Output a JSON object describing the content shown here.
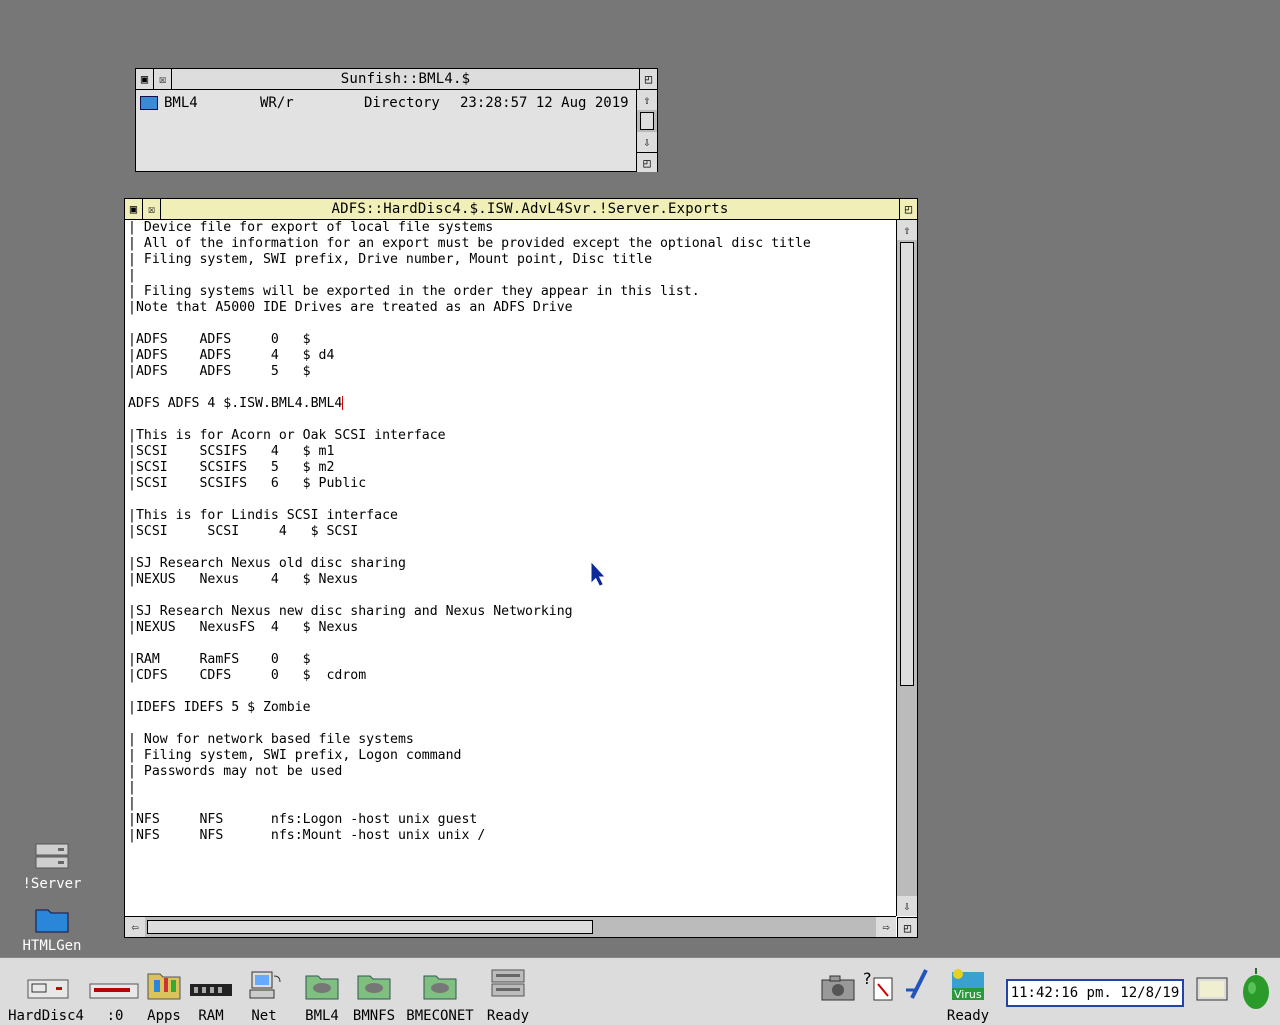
{
  "filer_window": {
    "title": "Sunfish::BML4.$",
    "row": {
      "name": "BML4",
      "access": "WR/r",
      "type": "Directory",
      "date": "23:28:57 12 Aug 2019"
    }
  },
  "editor_window": {
    "title": "ADFS::HardDisc4.$.ISW.AdvL4Svr.!Server.Exports",
    "lines": [
      "| Device file for export of local file systems",
      "| All of the information for an export must be provided except the optional disc title",
      "| Filing system, SWI prefix, Drive number, Mount point, Disc title",
      "|",
      "| Filing systems will be exported in the order they appear in this list.",
      "|Note that A5000 IDE Drives are treated as an ADFS Drive",
      "",
      "|ADFS    ADFS     0   $",
      "|ADFS    ADFS     4   $ d4",
      "|ADFS    ADFS     5   $",
      "",
      "ADFS ADFS 4 $.ISW.BML4.BML4",
      "",
      "|This is for Acorn or Oak SCSI interface",
      "|SCSI    SCSIFS   4   $ m1",
      "|SCSI    SCSIFS   5   $ m2",
      "|SCSI    SCSIFS   6   $ Public",
      "",
      "|This is for Lindis SCSI interface",
      "|SCSI     SCSI     4   $ SCSI",
      "",
      "|SJ Research Nexus old disc sharing",
      "|NEXUS   Nexus    4   $ Nexus",
      "",
      "|SJ Research Nexus new disc sharing and Nexus Networking",
      "|NEXUS   NexusFS  4   $ Nexus",
      "",
      "|RAM     RamFS    0   $",
      "|CDFS    CDFS     0   $  cdrom",
      "",
      "|IDEFS IDEFS 5 $ Zombie",
      "",
      "| Now for network based file systems",
      "| Filing system, SWI prefix, Logon command",
      "| Passwords may not be used",
      "|",
      "|",
      "|NFS     NFS      nfs:Logon -host unix guest",
      "|NFS     NFS      nfs:Mount -host unix unix /"
    ]
  },
  "desktop_icons": [
    {
      "label": "!Server",
      "icon": "server-icon"
    },
    {
      "label": "HTMLGen",
      "icon": "folder-icon"
    }
  ],
  "iconbar": {
    "left": [
      {
        "label": "HardDisc4",
        "icon": "harddisc-icon"
      },
      {
        "label": ":0",
        "icon": "floppy-icon"
      },
      {
        "label": "Apps",
        "icon": "apps-icon"
      },
      {
        "label": "RAM",
        "icon": "ram-icon"
      },
      {
        "label": "Net",
        "icon": "network-icon"
      },
      {
        "label": "BML4",
        "icon": "share-folder-icon"
      },
      {
        "label": "BMNFS",
        "icon": "share-folder-icon"
      },
      {
        "label": "BMECONET",
        "icon": "share-folder-icon"
      },
      {
        "label": "Ready",
        "icon": "server-drive-icon"
      }
    ],
    "right": [
      {
        "label": "",
        "icon": "camera-icon"
      },
      {
        "label": "",
        "icon": "help-icon"
      },
      {
        "label": "",
        "icon": "paint-icon"
      },
      {
        "label": "Ready",
        "icon": "virus-icon",
        "badge": "Virus"
      },
      {
        "label": "",
        "icon": "monitor-icon"
      },
      {
        "label": "",
        "icon": "acorn-icon"
      }
    ],
    "clock": "11:42:16 pm. 12/8/19"
  }
}
